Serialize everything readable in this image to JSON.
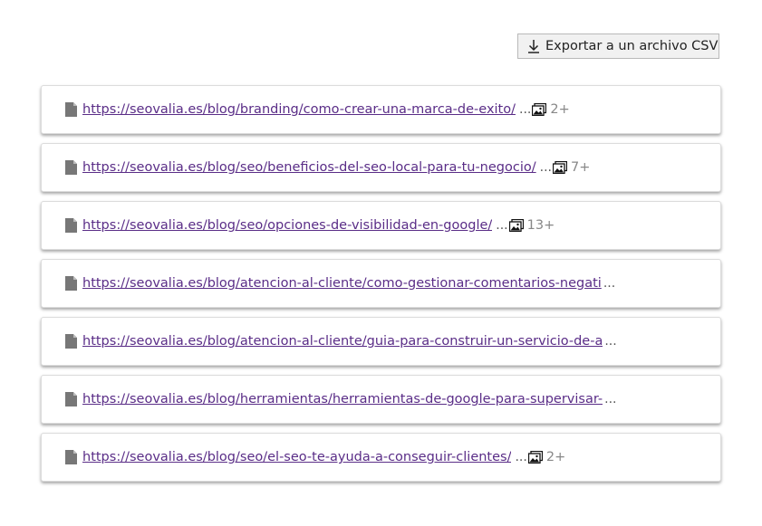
{
  "export_button": {
    "label": "Exportar a un archivo CSV",
    "icon": "download-icon"
  },
  "items": [
    {
      "url": "https://seovalia.es/blog/branding/como-crear-una-marca-de-exito/",
      "truncated": false,
      "image_count": "2+"
    },
    {
      "url": "https://seovalia.es/blog/seo/beneficios-del-seo-local-para-tu-negocio/",
      "truncated": false,
      "image_count": "7+"
    },
    {
      "url": "https://seovalia.es/blog/seo/opciones-de-visibilidad-en-google/",
      "truncated": false,
      "image_count": "13+"
    },
    {
      "url": "https://seovalia.es/blog/atencion-al-cliente/como-gestionar-comentarios-negati",
      "truncated": true,
      "image_count": null
    },
    {
      "url": "https://seovalia.es/blog/atencion-al-cliente/guia-para-construir-un-servicio-de-a",
      "truncated": true,
      "image_count": null
    },
    {
      "url": "https://seovalia.es/blog/herramientas/herramientas-de-google-para-supervisar-",
      "truncated": true,
      "image_count": null
    },
    {
      "url": "https://seovalia.es/blog/seo/el-seo-te-ayuda-a-conseguir-clientes/",
      "truncated": false,
      "image_count": "2+"
    }
  ],
  "ellipsis": "...",
  "colors": {
    "link": "#5a2d87",
    "icon": "#777777",
    "count": "#888888"
  }
}
